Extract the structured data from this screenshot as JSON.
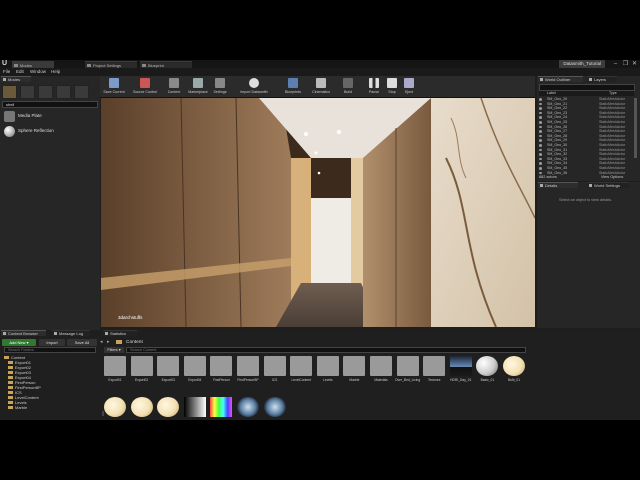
{
  "app": {
    "logo_glyph": "U",
    "doc_tabs": [
      "Modes",
      "Project Settings",
      "Blueprint"
    ],
    "project_name": "Datasmith_Tutorial",
    "window_controls": [
      "–",
      "❐",
      "✕"
    ]
  },
  "menu": [
    "File",
    "Edit",
    "Window",
    "Help"
  ],
  "modes_panel": {
    "tab": "Modes",
    "search_value": "shell",
    "items": [
      {
        "label": "Media Plate",
        "icon": "media-plate-icon"
      },
      {
        "label": "Sphere Reflection",
        "icon": "sphere-reflection-icon"
      }
    ]
  },
  "toolbar": [
    {
      "label": "Save Current",
      "icon": "save-icon"
    },
    {
      "label": "Source Control",
      "icon": "source-control-icon"
    },
    {
      "label": "Content",
      "icon": "content-icon"
    },
    {
      "label": "Marketplace",
      "icon": "marketplace-icon"
    },
    {
      "label": "Settings",
      "icon": "settings-icon"
    },
    {
      "label": "Import Datasmith",
      "icon": "datasmith-icon"
    },
    {
      "label": "Blueprints",
      "icon": "blueprints-icon"
    },
    {
      "label": "Cinematics",
      "icon": "cinematics-icon"
    },
    {
      "label": "Build",
      "icon": "build-icon"
    },
    {
      "label": "Pause",
      "icon": "pause-icon"
    },
    {
      "label": "Stop",
      "icon": "stop-icon"
    },
    {
      "label": "Eject",
      "icon": "eject-icon"
    }
  ],
  "viewport": {
    "watermark": "3darchstuffs"
  },
  "world_outliner": {
    "tabs": [
      "World Outliner",
      "Layers"
    ],
    "columns": [
      "Label",
      "Type"
    ],
    "rows": [
      {
        "label": "SM_Geo_20",
        "type": "StaticMeshActor"
      },
      {
        "label": "SM_Geo_21",
        "type": "StaticMeshActor"
      },
      {
        "label": "SM_Geo_22",
        "type": "StaticMeshActor"
      },
      {
        "label": "SM_Geo_23",
        "type": "StaticMeshActor"
      },
      {
        "label": "SM_Geo_24",
        "type": "StaticMeshActor"
      },
      {
        "label": "SM_Geo_25",
        "type": "StaticMeshActor"
      },
      {
        "label": "SM_Geo_26",
        "type": "StaticMeshActor"
      },
      {
        "label": "SM_Geo_27",
        "type": "StaticMeshActor"
      },
      {
        "label": "SM_Geo_28",
        "type": "StaticMeshActor"
      },
      {
        "label": "SM_Geo_29",
        "type": "StaticMeshActor"
      },
      {
        "label": "SM_Geo_30",
        "type": "StaticMeshActor"
      },
      {
        "label": "SM_Geo_31",
        "type": "StaticMeshActor"
      },
      {
        "label": "SM_Geo_32",
        "type": "StaticMeshActor"
      },
      {
        "label": "SM_Geo_33",
        "type": "StaticMeshActor"
      },
      {
        "label": "SM_Geo_34",
        "type": "StaticMeshActor"
      },
      {
        "label": "SM_Geo_35",
        "type": "StaticMeshActor"
      },
      {
        "label": "SM_Geo_36",
        "type": "StaticMeshActor"
      }
    ],
    "actor_count": "882 actors",
    "view_options": "View Options"
  },
  "details": {
    "tabs": [
      "Details",
      "World Settings"
    ],
    "empty_text": "Select an object to view details."
  },
  "content_browser": {
    "tabs": [
      "Content Browser",
      "Message Log",
      "Statistics"
    ],
    "add_new": "Add New",
    "import": "Import",
    "save_all": "Save All",
    "path": "Content",
    "filters": "Filters",
    "search_folders_placeholder": "Search Folders",
    "search_content_placeholder": "Search Content",
    "tree": [
      "Content",
      "Export01",
      "Export02",
      "Export03",
      "Export04",
      "FirstPerson",
      "FirstPersonBP",
      "ICS",
      "LevelContent",
      "Levels",
      "Marble"
    ],
    "assets_row1": [
      {
        "label": "Export01",
        "kind": "folder"
      },
      {
        "label": "Export02",
        "kind": "folder"
      },
      {
        "label": "Export03",
        "kind": "folder"
      },
      {
        "label": "Export04",
        "kind": "folder"
      },
      {
        "label": "FirstPerson",
        "kind": "folder"
      },
      {
        "label": "FirstPersonBP",
        "kind": "folder"
      },
      {
        "label": "ICS",
        "kind": "folder"
      },
      {
        "label": "LevelContent",
        "kind": "folder"
      },
      {
        "label": "Levels",
        "kind": "folder"
      },
      {
        "label": "Marble",
        "kind": "folder"
      },
      {
        "label": "Materials",
        "kind": "folder"
      },
      {
        "label": "Over_Bed_Living",
        "kind": "folder"
      },
      {
        "label": "Textures",
        "kind": "folder"
      },
      {
        "label": "HDRI_Day_01",
        "kind": "hdri"
      },
      {
        "label": "Basic_01",
        "kind": "sphere-white"
      },
      {
        "label": "Bulb_01",
        "kind": "sphere-warm"
      }
    ],
    "assets_row2": [
      {
        "label": "",
        "kind": "sphere-warm"
      },
      {
        "label": "",
        "kind": "sphere-warm"
      },
      {
        "label": "",
        "kind": "sphere-warm"
      },
      {
        "label": "",
        "kind": "gradient"
      },
      {
        "label": "",
        "kind": "rainbow"
      },
      {
        "label": "",
        "kind": "cube-map"
      },
      {
        "label": "",
        "kind": "cube-map"
      }
    ]
  },
  "colors": {
    "accent_green": "#2f7a2f",
    "folder_gray": "#9a9a9a",
    "warm_light": "#f3e1b4"
  }
}
